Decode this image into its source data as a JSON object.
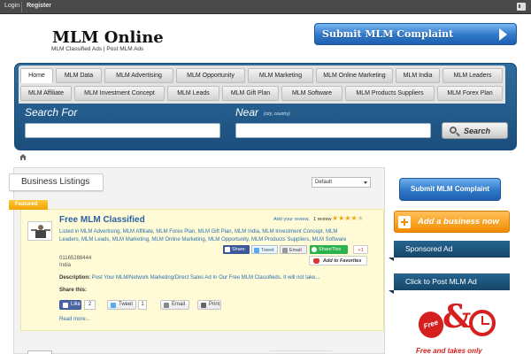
{
  "topbar": {
    "login": "Login",
    "register": "Register",
    "icon": "rss-icon"
  },
  "header": {
    "site_name": "MLM Online",
    "tagline": "MLM Classified Ads | Post MLM Ads",
    "submit_complaint": "Submit MLM Complaint"
  },
  "nav": {
    "items": [
      "Home",
      "MLM Data",
      "MLM Advertising",
      "MLM Opportunity",
      "MLM Marketing",
      "MLM Online Marketing",
      "MLM India",
      "MLM Leaders",
      "MLM Affiliate",
      "MLM Investment Concept",
      "MLM Leads",
      "MLM Gift Plan",
      "MLM Software",
      "MLM Products Suppliers",
      "MLM Forex Plan"
    ],
    "active": "Home"
  },
  "search": {
    "search_label": "Search For",
    "near_label": "Near",
    "near_hint": "(city, country)",
    "search_value": "",
    "near_value": "",
    "button": "Search"
  },
  "listings": {
    "heading": "Business Listings",
    "sort_selected": "Default",
    "item": {
      "badge": "Featured",
      "title": "Free MLM Classified",
      "review_link": "Add your review,",
      "review_count": "1 review",
      "rating": 4,
      "rating_max": 5,
      "categories": "Listed in MLM Advertising, MLM Affiliate, MLM Forex Plan, MLM Gift Plan, MLM India, MLM Investment Concept, MLM Leaders, MLM Leads, MLM Marketing, MLM Online Marketing, MLM Opportunity, MLM Products Suppliers, MLM Software",
      "phone": "01165288444",
      "location": "India",
      "description_label": "Description:",
      "description": "Post Your MLM/Network Marketing/Direct Sales Ad In Our Free MLM Classifieds. It will not take...",
      "share_top": {
        "facebook": "Share",
        "twitter": "Tweet",
        "email": "Email",
        "sharethis": "ShareThis",
        "gplus": "+1"
      },
      "favorite": "Add to Favorites",
      "share_label": "Share this:",
      "share_bottom": {
        "like": "Like",
        "like_count": "2",
        "tweet": "Tweet",
        "tweet_count": "1",
        "email": "Email",
        "print": "Print"
      },
      "read_more": "Read more..."
    }
  },
  "sidebar": {
    "submit_complaint": "Submit MLM Complaint",
    "add_business": "Add a business now",
    "sponsored": "Sponsored Ad",
    "post_ad": "Click to Post MLM Ad",
    "ad_free": "Free",
    "ad_amp": "&",
    "ad_text": "Free and takes only"
  },
  "colors": {
    "brand_blue": "#2f78c8",
    "nav_panel": "#1b4e7c",
    "featured": "#f0a500",
    "accent_orange": "#f28c00",
    "ad_red": "#d62020"
  }
}
